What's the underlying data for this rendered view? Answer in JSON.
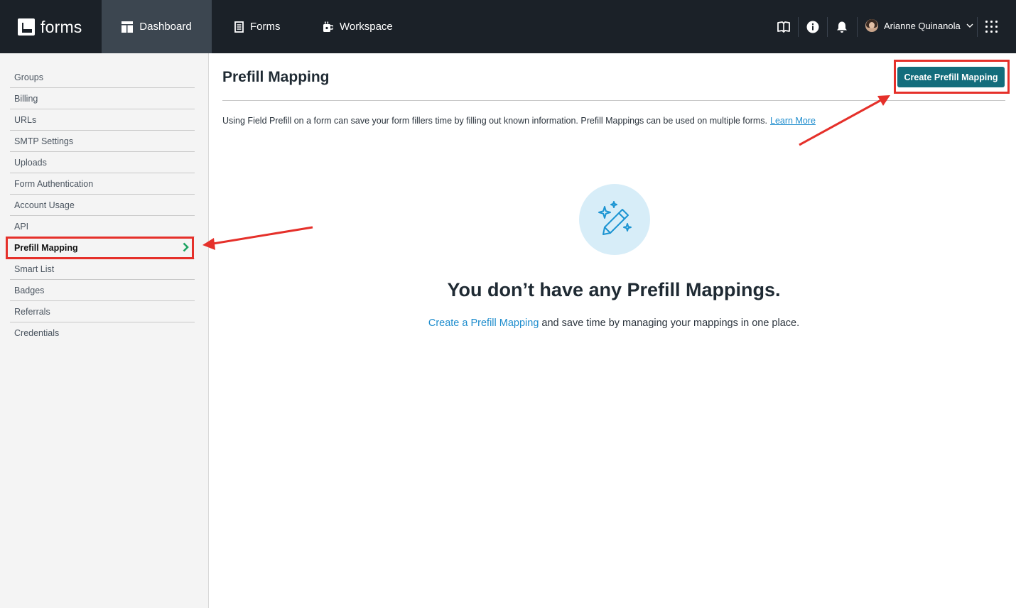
{
  "header": {
    "logo_text": "forms",
    "tabs": [
      {
        "label": "Dashboard",
        "icon": "dashboard-icon",
        "active": true
      },
      {
        "label": "Forms",
        "icon": "document-icon",
        "active": false
      },
      {
        "label": "Workspace",
        "icon": "workspace-icon",
        "active": false
      }
    ],
    "icons": [
      "book-icon",
      "info-icon",
      "bell-icon",
      "apps-grid-icon"
    ],
    "user_name": "Arianne Quinanola"
  },
  "sidebar": {
    "items": [
      {
        "label": "Groups"
      },
      {
        "label": "Billing"
      },
      {
        "label": "URLs"
      },
      {
        "label": "SMTP Settings"
      },
      {
        "label": "Uploads"
      },
      {
        "label": "Form Authentication"
      },
      {
        "label": "Account Usage"
      },
      {
        "label": "API"
      },
      {
        "label": "Prefill Mapping",
        "active": true
      },
      {
        "label": "Smart List"
      },
      {
        "label": "Badges"
      },
      {
        "label": "Referrals"
      },
      {
        "label": "Credentials"
      }
    ]
  },
  "main": {
    "title": "Prefill Mapping",
    "create_button": "Create Prefill Mapping",
    "intro_text": "Using Field Prefill on a form can save your form fillers time by filling out known information. Prefill Mappings can be used on multiple forms.",
    "learn_more": "Learn More",
    "empty_title": "You don’t have any Prefill Mappings.",
    "empty_link": "Create a Prefill Mapping",
    "empty_rest": "and save time by managing your mappings in one place."
  },
  "colors": {
    "topbar": "#1b2128",
    "active_tab": "#3c4650",
    "button": "#136d7c",
    "link": "#1d8ccd",
    "annotation": "#e5302a",
    "active_chevron": "#1fa463"
  }
}
